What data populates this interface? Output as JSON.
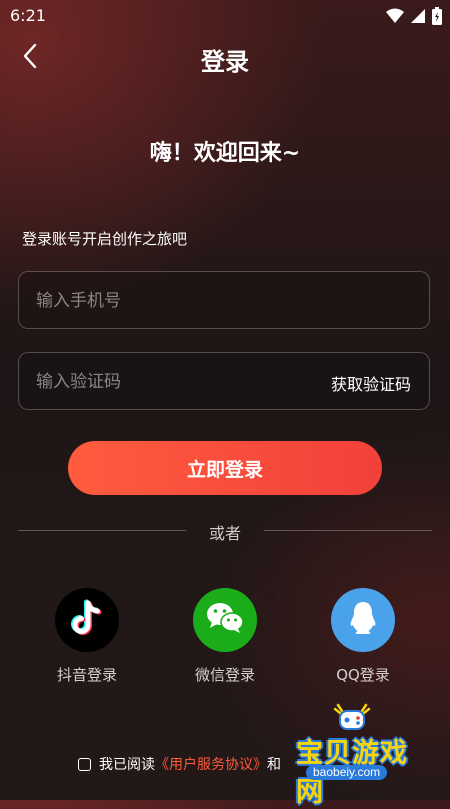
{
  "status_bar": {
    "time": "6:21"
  },
  "header": {
    "title": "登录"
  },
  "welcome": "嗨！欢迎回来~",
  "subtitle": "登录账号开启创作之旅吧",
  "phone_input": {
    "placeholder": "输入手机号",
    "value": ""
  },
  "code_input": {
    "placeholder": "输入验证码",
    "value": "",
    "get_code_label": "获取验证码"
  },
  "login_button": "立即登录",
  "divider_text": "或者",
  "social_logins": [
    {
      "label": "抖音登录",
      "icon": "tiktok-icon",
      "color": "#000000"
    },
    {
      "label": "微信登录",
      "icon": "wechat-icon",
      "color": "#1aad19"
    },
    {
      "label": "QQ登录",
      "icon": "qq-icon",
      "color": "#4aa3ea"
    }
  ],
  "agreement": {
    "prefix": "我已阅读",
    "link": "《用户服务协议》",
    "suffix": "和"
  },
  "watermark": {
    "title": "宝贝游戏网",
    "url": "baobeiy.com"
  },
  "colors": {
    "accent": "#f2403a",
    "link": "#ff5a3c"
  }
}
